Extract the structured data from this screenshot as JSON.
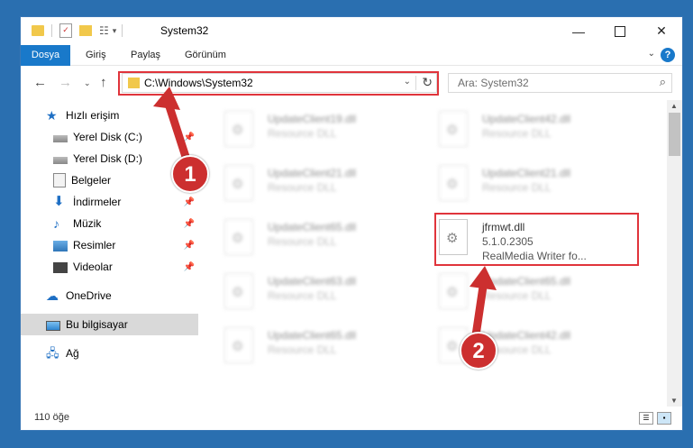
{
  "window": {
    "title": "System32"
  },
  "ribbon": {
    "tabs": [
      "Dosya",
      "Giriş",
      "Paylaş",
      "Görünüm"
    ],
    "help": "?"
  },
  "address": {
    "path": "C:\\Windows\\System32",
    "search_placeholder": "Ara: System32"
  },
  "sidebar": {
    "items": [
      {
        "label": "Hızlı erişim",
        "icon": "star-icon"
      },
      {
        "label": "Yerel Disk (C:)",
        "icon": "drive-icon"
      },
      {
        "label": "Yerel Disk (D:)",
        "icon": "drive-icon"
      },
      {
        "label": "Belgeler",
        "icon": "documents-icon"
      },
      {
        "label": "İndirmeler",
        "icon": "download-icon"
      },
      {
        "label": "Müzik",
        "icon": "music-icon"
      },
      {
        "label": "Resimler",
        "icon": "pictures-icon"
      },
      {
        "label": "Videolar",
        "icon": "videos-icon"
      },
      {
        "label": "OneDrive",
        "icon": "cloud-icon"
      },
      {
        "label": "Bu bilgisayar",
        "icon": "computer-icon"
      },
      {
        "label": "Ağ",
        "icon": "network-icon"
      }
    ]
  },
  "files": [
    {
      "name": "UpdateClient19.dll",
      "desc": "Resource DLL"
    },
    {
      "name": "UpdateClient42.dll",
      "desc": "Resource DLL"
    },
    {
      "name": "UpdateClient21.dll",
      "desc": "Resource DLL"
    },
    {
      "name": "UpdateClient21.dll",
      "desc": "Resource DLL"
    },
    {
      "name": "UpdateClient65.dll",
      "desc": "Resource DLL"
    },
    {
      "name": "UpdateClient63.dll",
      "desc": "Resource DLL"
    },
    {
      "name": "UpdateClient65.dll",
      "desc": "Resource DLL"
    },
    {
      "name": "UpdateClient65.dll",
      "desc": "Resource DLL"
    },
    {
      "name": "UpdateClient42.dll",
      "desc": "Resource DLL"
    }
  ],
  "highlight_file": {
    "name": "jfrmwt.dll",
    "version": "5.1.0.2305",
    "desc": "RealMedia Writer fo..."
  },
  "status": {
    "count": "110 öğe"
  },
  "annotations": {
    "badge1": "1",
    "badge2": "2",
    "color": "#e0343b"
  }
}
